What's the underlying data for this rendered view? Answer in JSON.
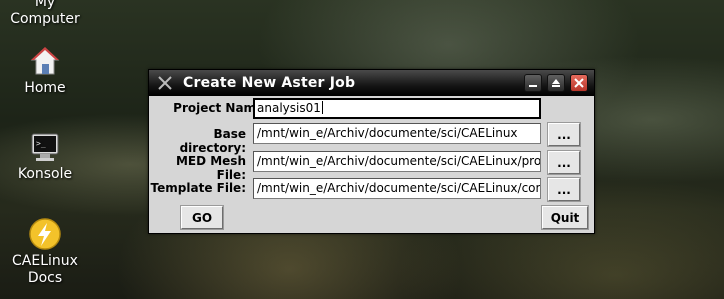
{
  "desktop": {
    "icons": [
      {
        "label": "My\nComputer"
      },
      {
        "label": "Home"
      },
      {
        "label": "Konsole"
      },
      {
        "label": "CAELinux\nDocs"
      }
    ]
  },
  "window": {
    "title": "Create New Aster Job",
    "fields": {
      "project_name": {
        "label": "Project Name:",
        "value": "analysis01"
      },
      "base_directory": {
        "label": "Base directory:",
        "value": "/mnt/win_e/Archiv/documente/sci/CAELinux"
      },
      "med_mesh_file": {
        "label": "MED Mesh File:",
        "value": "/mnt/win_e/Archiv/documente/sci/CAELinux/profil_"
      },
      "template_file": {
        "label": "Template File:",
        "value": "/mnt/win_e/Archiv/documente/sci/CAELinux/comm"
      }
    },
    "browse_label": "...",
    "go_label": "GO",
    "quit_label": "Quit"
  },
  "colors": {
    "window_bg": "#d6d6d6",
    "titlebar": "#000000",
    "close_button": "#d04a3c"
  }
}
